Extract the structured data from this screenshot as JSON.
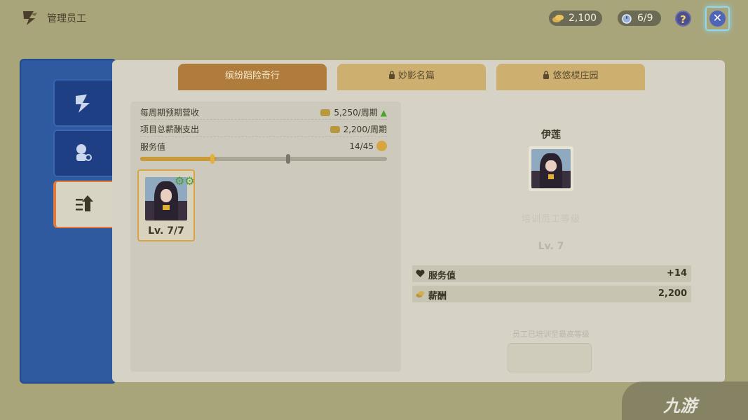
{
  "header": {
    "title": "管理员工",
    "coins": "2,100",
    "staff_count": "6/9",
    "help_label": "?",
    "close_label": "✕"
  },
  "tabs": [
    {
      "label": "缤纷蹈险奇行",
      "locked": false
    },
    {
      "label": "妙影名篇",
      "locked": true
    },
    {
      "label": "悠悠棂庄园",
      "locked": true
    }
  ],
  "summary": {
    "weekly_income_label": "每周期预期营收",
    "weekly_income_value": "5,250/周期",
    "salary_label": "项目总薪酬支出",
    "salary_value": "2,200/周期",
    "service_label": "服务值",
    "service_value": "14/45",
    "service_progress": 0.31
  },
  "staff": [
    {
      "level": "Lv. 7/7"
    }
  ],
  "detail": {
    "name": "伊莲",
    "train_label": "培训员工等级",
    "level": "Lv. 7",
    "attrs": [
      {
        "label": "服务值",
        "value": "+14",
        "icon": "heart-icon"
      },
      {
        "label": "薪酬",
        "value": "2,200",
        "icon": "coin-icon"
      }
    ],
    "max_note": "员工已培训至最高等级"
  },
  "watermark": "九游",
  "colors": {
    "accent": "#b07c3c",
    "sidebar": "#2f5aa0",
    "up_arrow": "#4ba32e"
  }
}
